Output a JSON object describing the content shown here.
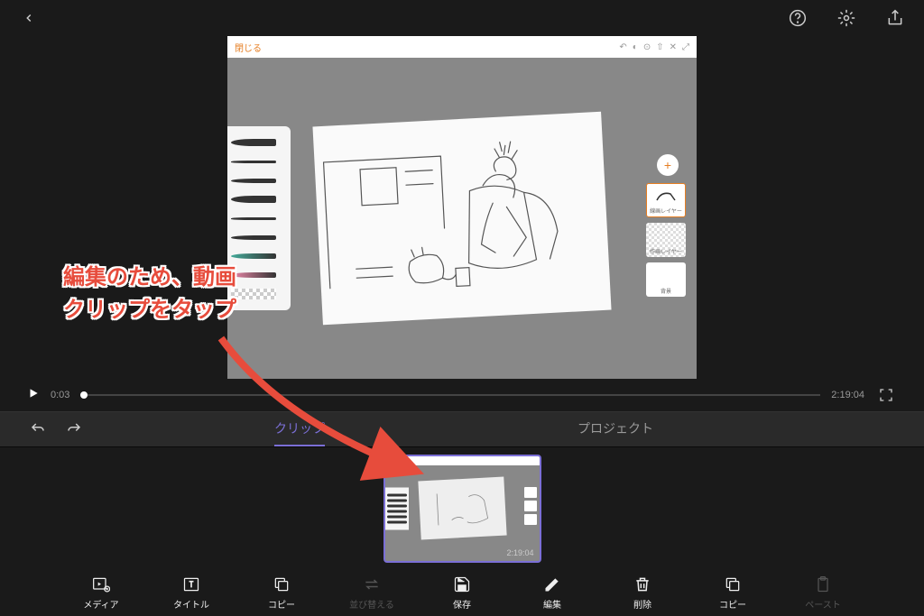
{
  "canvas": {
    "close_label": "閉じる",
    "layer1_label": "線画レイヤー",
    "layer2_label": "作画レイヤー",
    "layer3_label": "背景"
  },
  "playback": {
    "current_time": "0:03",
    "total_time": "2:19:04"
  },
  "tabs": {
    "clip": "クリップ",
    "project": "プロジェクト"
  },
  "clip": {
    "duration": "2:19:04"
  },
  "toolbar": {
    "media": "メディア",
    "title": "タイトル",
    "copy": "コピー",
    "reorder": "並び替える",
    "save": "保存",
    "edit": "編集",
    "delete": "削除",
    "copy2": "コピー",
    "paste": "ペースト"
  },
  "annotation": {
    "line1": "編集のため、動画",
    "line2": "クリップをタップ"
  }
}
